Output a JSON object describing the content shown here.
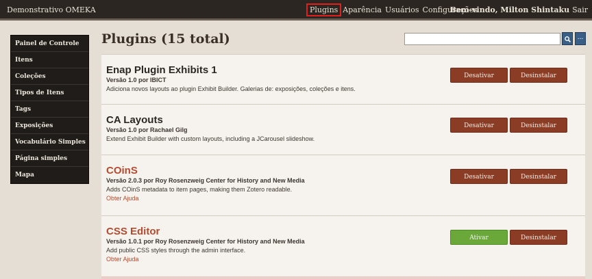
{
  "site": {
    "title": "Demonstrativo OMEKA"
  },
  "topnav": {
    "items": [
      "Plugins",
      "Aparência",
      "Usuários",
      "Configurações"
    ],
    "active": "Plugins"
  },
  "user": {
    "welcome": "Bem-vindo, Milton Shintaku",
    "logout": "Sair"
  },
  "sidebar": {
    "items": [
      {
        "label": "Painel de Controle"
      },
      {
        "label": "Itens"
      },
      {
        "label": "Coleções"
      },
      {
        "label": "Tipos de Itens"
      },
      {
        "label": "Tags"
      },
      {
        "label": "Exposições"
      },
      {
        "label": "Vocabulário Simples"
      },
      {
        "label": "Página simples"
      },
      {
        "label": "Mapa"
      }
    ]
  },
  "page": {
    "title": "Plugins (15 total)"
  },
  "search": {
    "placeholder": "",
    "button_icon": "search-icon",
    "more_label": "..."
  },
  "plugins": [
    {
      "name": "Enap Plugin Exhibits 1",
      "version": "Versão 1.0 por IBICT",
      "description": "Adiciona novos layouts ao plugin Exhibit Builder. Galerias de: exposições, coleções e itens.",
      "help": "",
      "primary_action": "Desativar",
      "uninstall": "Desinstalar"
    },
    {
      "name": "CA Layouts",
      "version": "Versão 1.0 por Rachael Gilg",
      "description": "Extend Exhibit Builder with custom layouts, including a JCarousel slideshow.",
      "help": "",
      "primary_action": "Desativar",
      "uninstall": "Desinstalar"
    },
    {
      "name": "COinS",
      "version": "Versão 2.0.3 por Roy Rosenzweig Center for History and New Media",
      "description": "Adds COinS metadata to item pages, making them Zotero readable.",
      "help": "Obter Ajuda",
      "primary_action": "Desativar",
      "uninstall": "Desinstalar"
    },
    {
      "name": "CSS Editor",
      "version": "Versão 1.0.1 por Roy Rosenzweig Center for History and New Media",
      "description": "Add public CSS styles through the admin interface.",
      "help": "Obter Ajuda",
      "primary_action": "Ativar",
      "uninstall": "Desinstalar"
    }
  ],
  "colors": {
    "topbar": "#2b2622",
    "sidebar": "#1f1c19",
    "deactivate_button": "#8a3c24",
    "activate_button": "#6aa83a",
    "inactive_plugin_name": "#b44a2e",
    "active_nav_highlight": "#e01f1f"
  }
}
